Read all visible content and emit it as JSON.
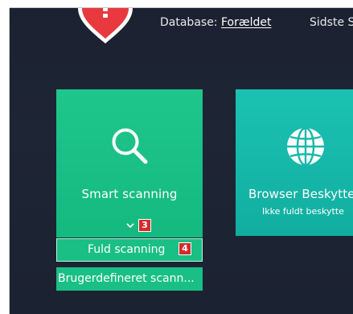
{
  "header": {
    "database_label": "Database:",
    "database_status": "Forældet",
    "last_update_label": "Sidste S"
  },
  "tiles": {
    "smart": {
      "title": "Smart scanning",
      "icon": "search-icon",
      "badge": "3"
    },
    "browser": {
      "title": "Browser Beskytte",
      "subtitle": "Ikke fuldt beskytte",
      "icon": "globe-icon"
    }
  },
  "scan_menu": {
    "full_scan": "Fuld scanning",
    "full_scan_badge": "4",
    "custom_scan": "Brugerdefineret scann..."
  },
  "colors": {
    "background": "#1b2232",
    "smart_tile": "#1fc68c",
    "browser_tile": "#1bc2b2",
    "badge": "#d62b2b",
    "shield": "#e8393f"
  }
}
